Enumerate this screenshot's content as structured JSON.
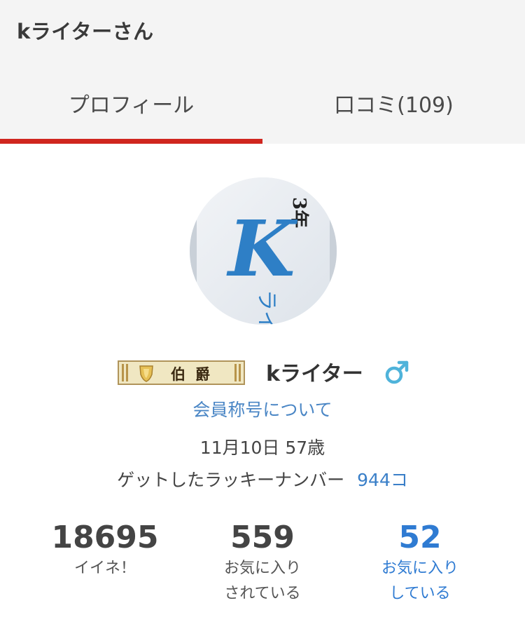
{
  "header": {
    "title": "kライターさん"
  },
  "tabs": [
    {
      "label": "プロフィール",
      "active": true
    },
    {
      "label": "口コミ(109)",
      "active": false
    }
  ],
  "profile": {
    "avatar": {
      "text_top": "3年",
      "letter": "K",
      "text_bottom": "ライ"
    },
    "rank_badge": "伯爵",
    "username": "kライター",
    "gender_icon": "male-symbol-icon",
    "member_title_link": "会員称号について",
    "birthday_age": "11月10日 57歳",
    "lucky_label": "ゲットしたラッキーナンバー",
    "lucky_count": "944コ"
  },
  "stats": [
    {
      "value": "18695",
      "label_line1": "イイネ！",
      "label_line2": ""
    },
    {
      "value": "559",
      "label_line1": "お気に入り",
      "label_line2": "されている"
    },
    {
      "value": "52",
      "label_line1": "お気に入り",
      "label_line2": "している"
    }
  ],
  "colors": {
    "accent_red": "#d0261f",
    "link_blue": "#4a86c5",
    "stat_blue": "#2f7bd2",
    "header_bg": "#f4f4f4",
    "male_icon": "#4fb3da"
  }
}
